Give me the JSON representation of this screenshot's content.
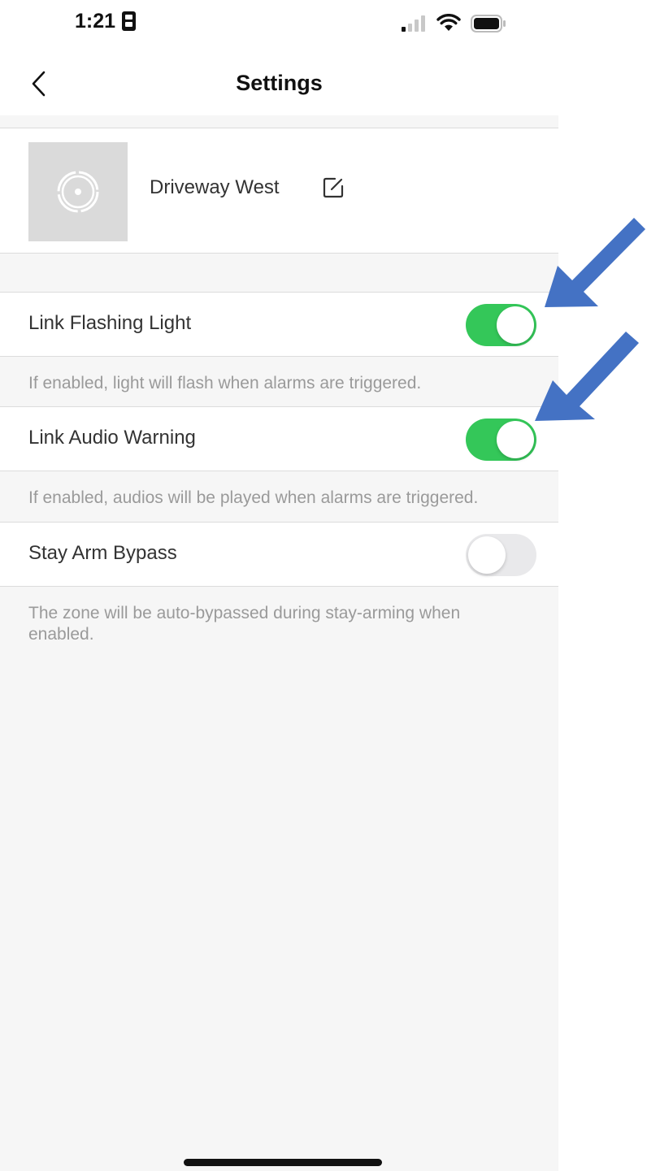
{
  "status_bar": {
    "time": "1:21",
    "sim_icon": "sim-card-icon",
    "signal_icon": "cellular-signal-icon",
    "wifi_icon": "wifi-icon",
    "battery_icon": "battery-icon"
  },
  "nav": {
    "title": "Settings",
    "back_icon": "chevron-left-icon"
  },
  "device": {
    "name": "Driveway West",
    "thumbnail_icon": "camera-lens-icon",
    "edit_icon": "edit-icon"
  },
  "settings": [
    {
      "label": "Link Flashing Light",
      "enabled": true,
      "hint": "If enabled, light will flash when alarms are triggered."
    },
    {
      "label": "Link Audio Warning",
      "enabled": true,
      "hint": "If enabled, audios will be played when alarms are triggered."
    },
    {
      "label": "Stay Arm Bypass",
      "enabled": false,
      "hint": "The zone will be auto-bypassed during stay-arming when enabled."
    }
  ],
  "colors": {
    "toggle_on": "#34c759",
    "toggle_off": "#e9e9eb",
    "annotation_arrow": "#4472c4",
    "background": "#f6f6f6"
  }
}
